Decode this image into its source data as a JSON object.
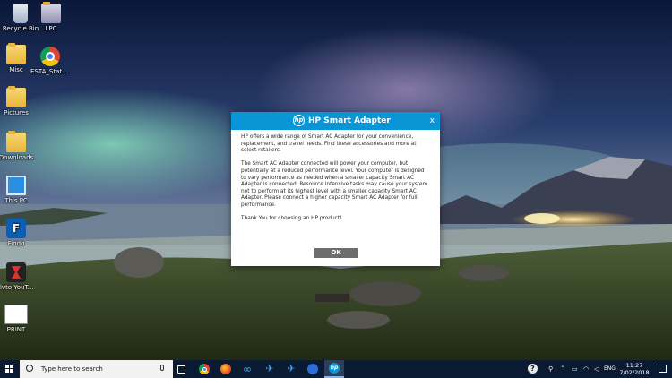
{
  "desktop": {
    "icons": [
      {
        "label": "Recycle Bin"
      },
      {
        "label": "LPC"
      },
      {
        "label": "Misc"
      },
      {
        "label": "ESTA_Status..."
      },
      {
        "label": "Pictures"
      },
      {
        "label": "Downloads"
      },
      {
        "label": "This PC"
      },
      {
        "label": "Findo"
      },
      {
        "label": "Flvto YouTube D..."
      },
      {
        "label": "PRINT"
      }
    ]
  },
  "dialog": {
    "title": "HP Smart Adapter",
    "logo_text": "hp",
    "close_label": "x",
    "paragraphs": [
      "HP offers a wide range of Smart AC Adapter for your convenience, replacement, and travel needs. Find these accessories and more at select retailers.",
      "The Smart AC Adapter connected will power your computer, but potentially at a reduced performance level. Your computer is designed to vary performance as needed when a smaller capacity Smart AC Adapter is connected. Resource intensive tasks may cause your system not to perform at its highest level with a smaller capacity Smart AC Adapter. Please connect a higher capacity Smart AC Adapter for full performance.",
      "Thank You for choosing an HP product!"
    ],
    "ok_label": "OK",
    "colors": {
      "title_bar": "#0a96d6",
      "ok_button": "#6d6d6d"
    }
  },
  "taskbar": {
    "search_placeholder": "Type here to search",
    "tray_text": "ENG",
    "clock_time": "11:27",
    "clock_date": "7/02/2018",
    "hp_logo_text": "hp"
  }
}
